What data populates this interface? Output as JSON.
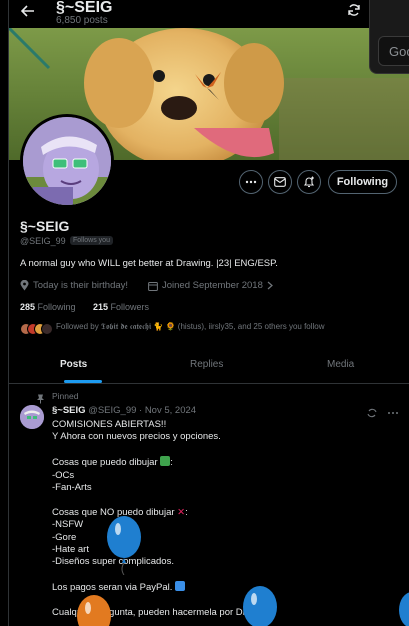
{
  "header": {
    "back_icon": "arrow-left-icon",
    "title": "§~SEIG",
    "post_count": "6,850 posts",
    "search_placeholder": "Goo"
  },
  "profile": {
    "name": "§~SEIG",
    "handle": "@SEIG_99",
    "follows_you": "Follows you",
    "bio": "A normal guy who WILL get better at Drawing. |23| ENG/ESP.",
    "birthday": "Today is their birthday!",
    "joined": "Joined September 2018",
    "following_count": "285",
    "following_label": "Following",
    "followers_count": "215",
    "followers_label": "Followers",
    "followed_by": "Followed by 𝕿𝖔𝖇𝖎𝖙 𝖉𝖊 𝖈𝖆𝖙𝖊𝖈𝖍𝖎 🐈 🌻 (histus), iirsly35, and 25 others you follow",
    "following_button": "Following"
  },
  "tabs": [
    {
      "label": "Posts",
      "active": true
    },
    {
      "label": "Replies",
      "active": false
    },
    {
      "label": "Media",
      "active": false
    }
  ],
  "tweet": {
    "pinned_label": "Pinned",
    "name": "§~SEIG",
    "handle_date": "@SEIG_99 · Nov 5, 2024",
    "line1": "COMISIONES ABIERTAS!!",
    "line2": "Y Ahora con nuevos precios y opciones.",
    "can_header": "Cosas que puedo dibujar",
    "can_items": [
      "-OCs",
      "-Fan-Arts"
    ],
    "cannot_header": "Cosas que NO puedo dibujar",
    "cannot_items": [
      "-NSFW",
      "-Gore",
      "-Hate art",
      "-Diseños super complicados."
    ],
    "payment": "Los pagos seran via PayPal.",
    "cutoff": "Cualquier pregunta, pueden hacermela por DM ^^"
  },
  "colors": {
    "accent": "#1d9bf0",
    "check": "#3fa34d",
    "paypal_box": "#3a8fe8",
    "balloon_blue": "#1f7fd0",
    "balloon_orange": "#e27a20"
  }
}
